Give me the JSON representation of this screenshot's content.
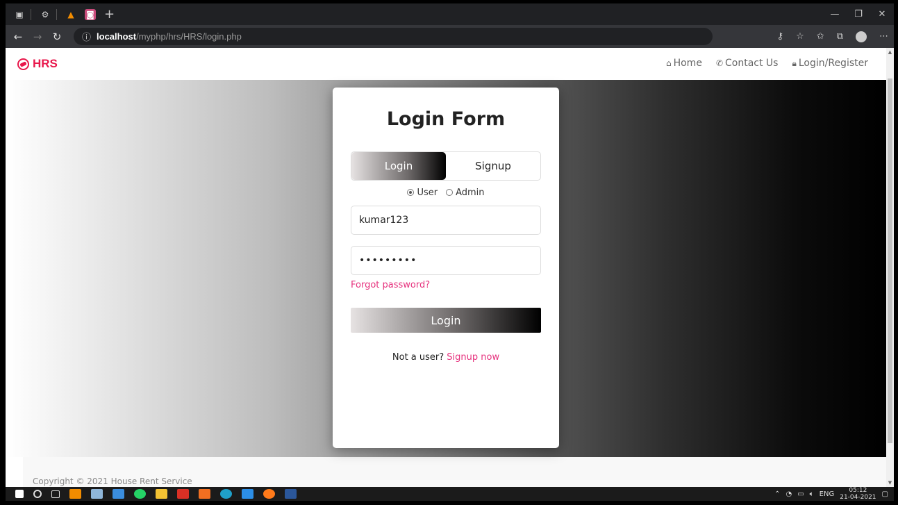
{
  "browser": {
    "url_host": "localhost",
    "url_path": "/myphp/hrs/HRS/login.php",
    "info_icon": "info-icon"
  },
  "navbar": {
    "brand": "HRS",
    "links": {
      "home": "Home",
      "contact": "Contact Us",
      "login": "Login/Register"
    }
  },
  "form": {
    "title": "Login Form",
    "tab_login": "Login",
    "tab_signup": "Signup",
    "role_user": "User",
    "role_admin": "Admin",
    "username_value": "kumar123",
    "password_value": "•••••••••",
    "forgot": "Forgot password?",
    "submit": "Login",
    "not_user": "Not a user?",
    "signup_now": "Signup now"
  },
  "footer": {
    "text": "Copyright © 2021 House Rent Service"
  },
  "taskbar": {
    "lang": "ENG",
    "time": "05:12",
    "date": "21-04-2021"
  },
  "colors": {
    "brand": "#e8174b",
    "link": "#e6317d"
  }
}
